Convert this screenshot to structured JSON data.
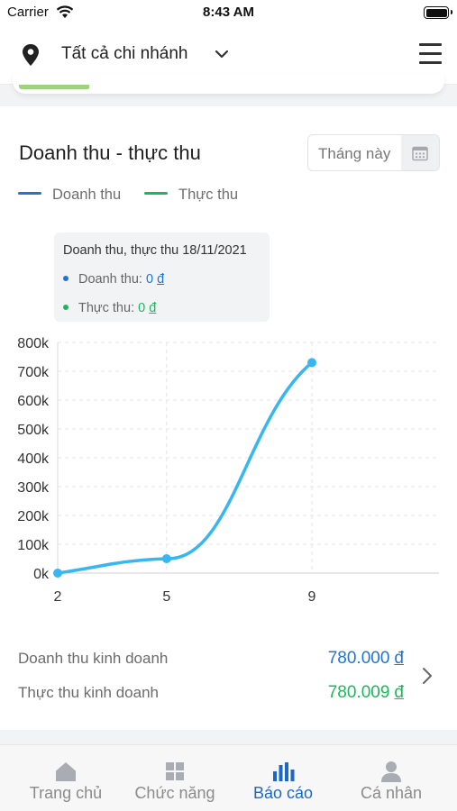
{
  "status_bar": {
    "carrier": "Carrier",
    "time": "8:43 AM"
  },
  "header": {
    "branch_selector": "Tất cả chi nhánh"
  },
  "card": {
    "title": "Doanh thu - thực thu",
    "period": "Tháng này",
    "legend": [
      {
        "label": "Doanh thu",
        "color": "#1e74d8"
      },
      {
        "label": "Thực thu",
        "color": "#19b95a"
      }
    ],
    "tooltip": {
      "title": "Doanh thu, thực thu 18/11/2021",
      "revenue_label": "Doanh thu:",
      "revenue_value": "0",
      "collected_label": "Thực thu:",
      "collected_value": "0",
      "currency": "đ"
    },
    "summary": {
      "revenue_label": "Doanh thu kinh doanh",
      "revenue_value": "780.000",
      "collected_label": "Thực thu kinh doanh",
      "collected_value": "780.009",
      "currency": "đ"
    }
  },
  "chart_data": {
    "type": "line",
    "y_tick_labels": [
      "0k",
      "100k",
      "200k",
      "300k",
      "400k",
      "500k",
      "600k",
      "700k",
      "800k"
    ],
    "x_tick_labels": [
      "2",
      "5",
      "9"
    ],
    "ylim": [
      0,
      800000
    ],
    "grid": true,
    "series": [
      {
        "color": "#36b6f2",
        "x": [
          2,
          5,
          9
        ],
        "values": [
          0,
          50000,
          730000
        ]
      }
    ]
  },
  "tabbar": {
    "tabs": [
      {
        "label": "Trang chủ",
        "icon": "home-icon",
        "active": false
      },
      {
        "label": "Chức năng",
        "icon": "grid-icon",
        "active": false
      },
      {
        "label": "Báo cáo",
        "icon": "bar-chart-icon",
        "active": true
      },
      {
        "label": "Cá nhân",
        "icon": "person-icon",
        "active": false
      }
    ],
    "active_color": "#1d68c7",
    "inactive_color": "#8b8b8b"
  }
}
